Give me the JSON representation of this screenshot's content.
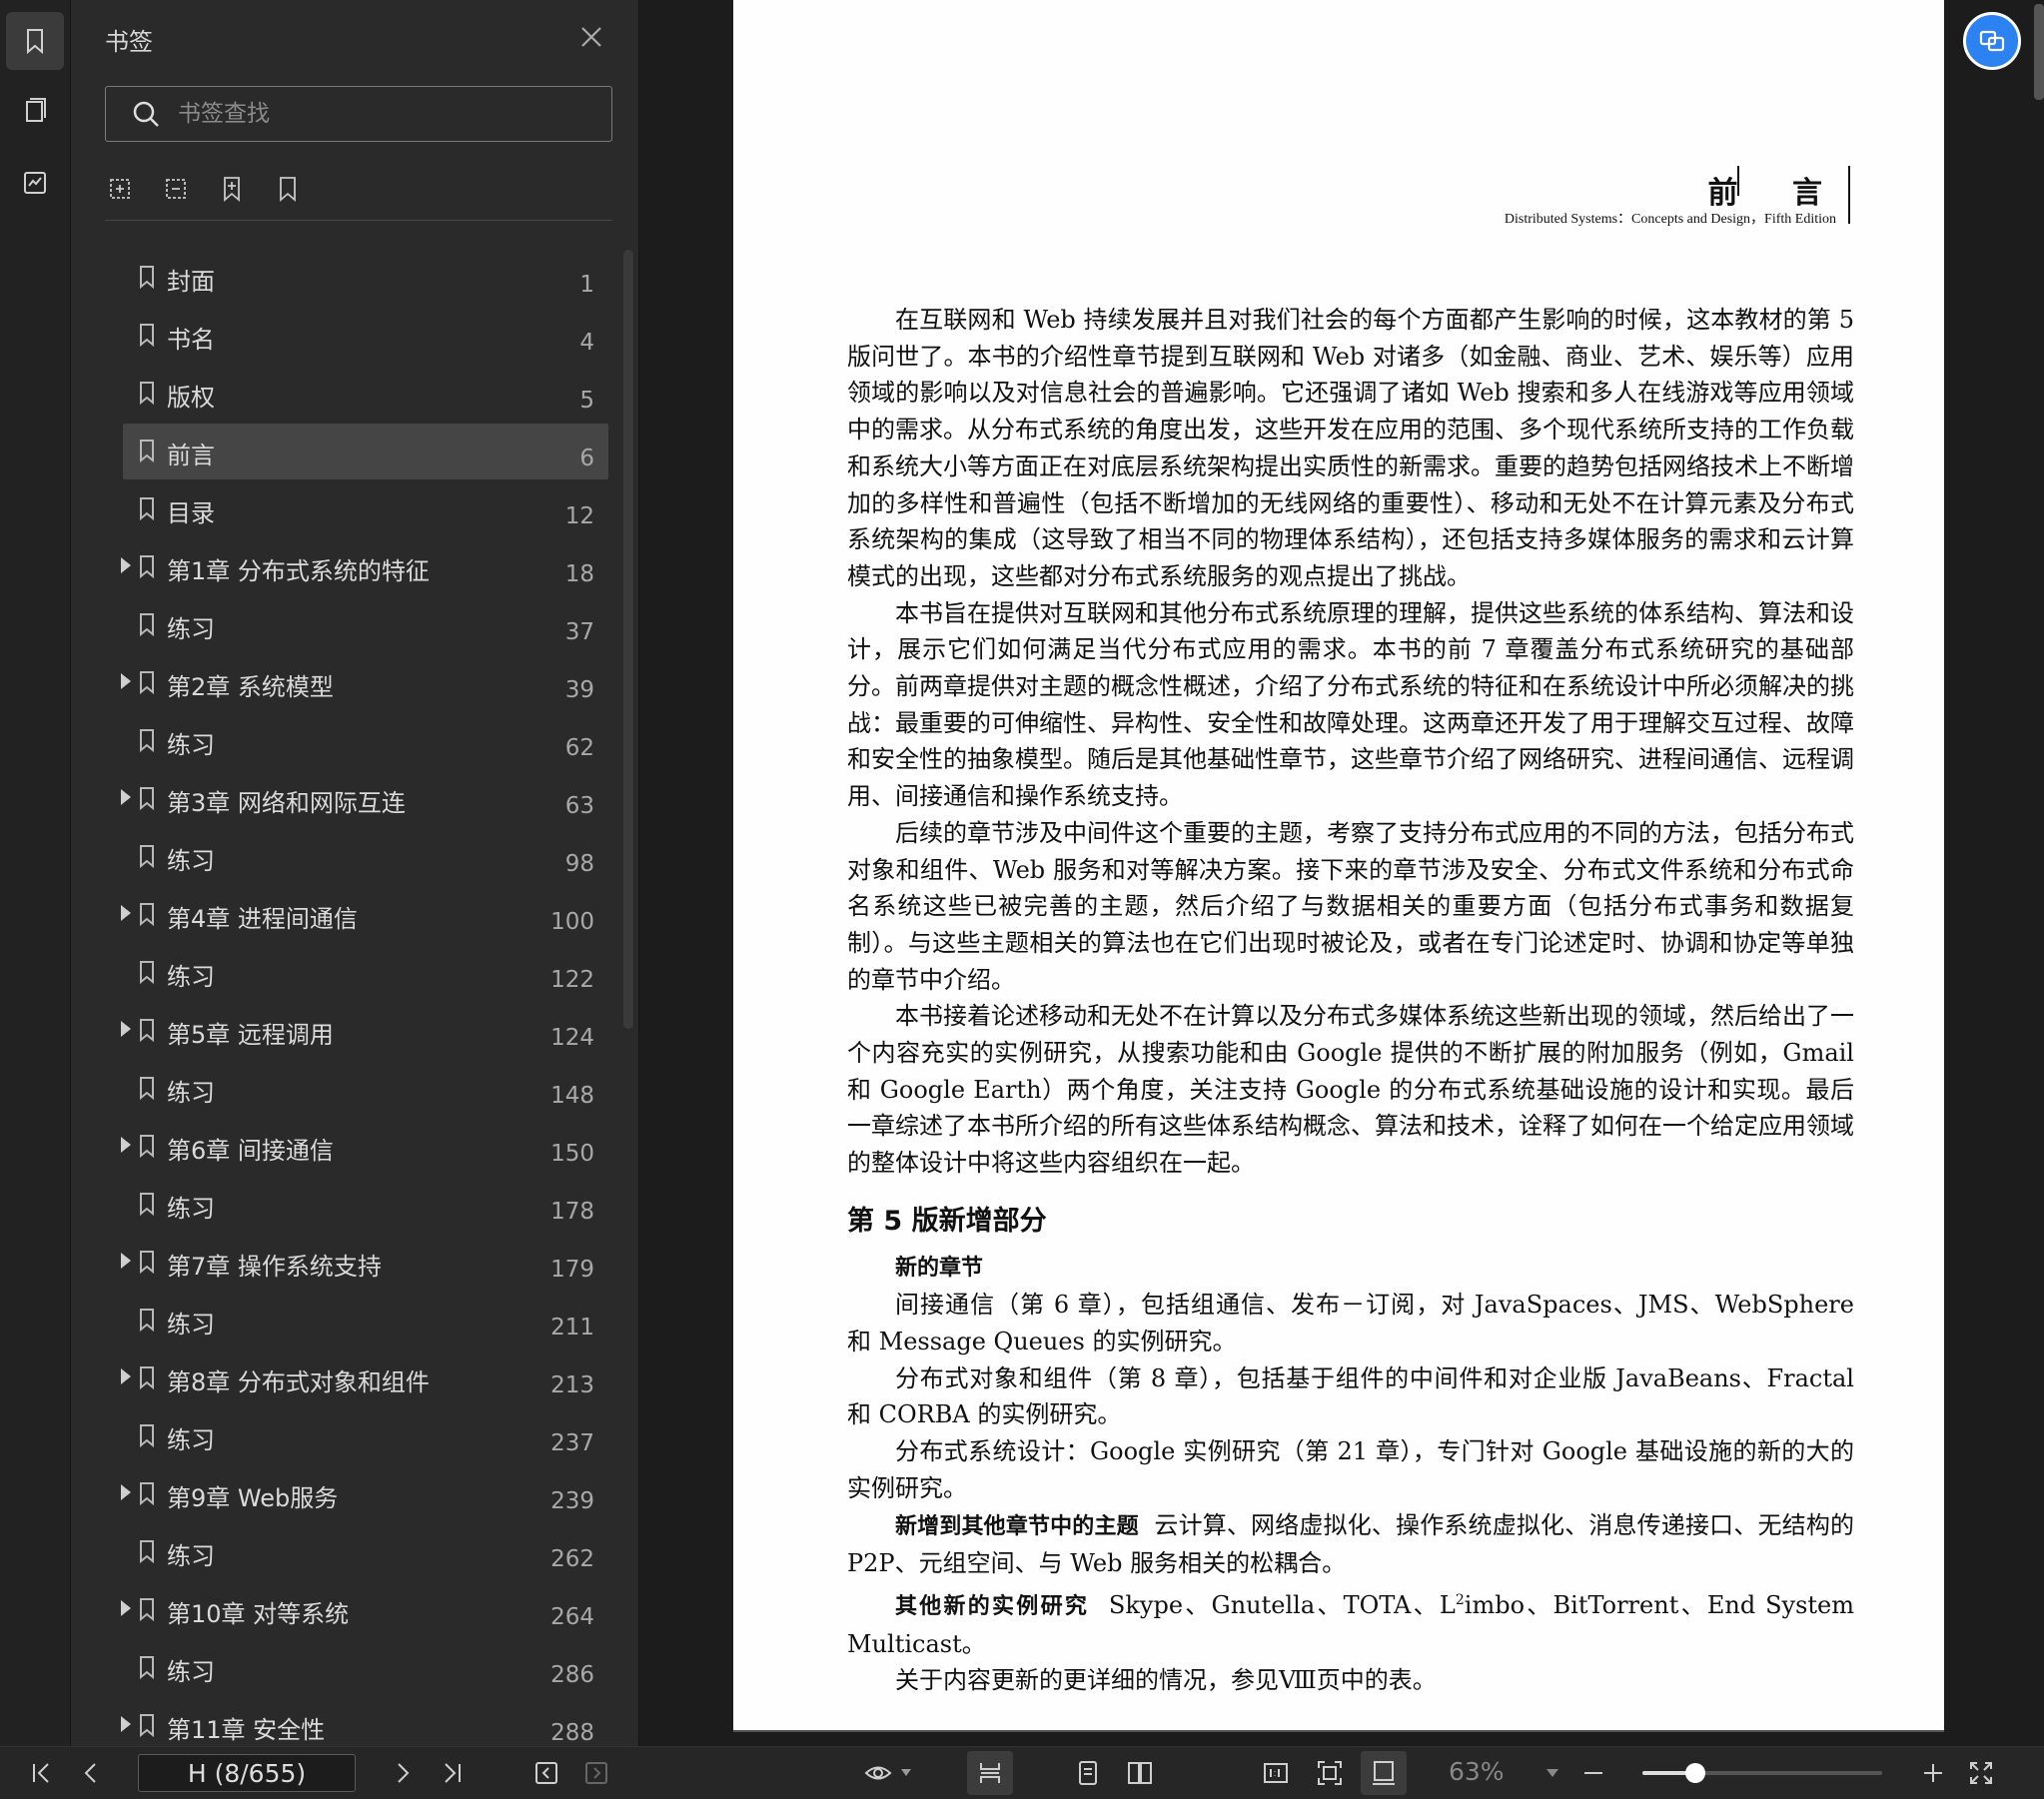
{
  "sidebar": {
    "title": "书签",
    "search_placeholder": "书签查找",
    "bookmarks": [
      {
        "label": "封面",
        "page": "1",
        "expandable": false,
        "selected": false
      },
      {
        "label": "书名",
        "page": "4",
        "expandable": false,
        "selected": false
      },
      {
        "label": "版权",
        "page": "5",
        "expandable": false,
        "selected": false
      },
      {
        "label": "前言",
        "page": "6",
        "expandable": false,
        "selected": true
      },
      {
        "label": "目录",
        "page": "12",
        "expandable": false,
        "selected": false
      },
      {
        "label": "第1章 分布式系统的特征",
        "page": "18",
        "expandable": true,
        "selected": false
      },
      {
        "label": "练习",
        "page": "37",
        "expandable": false,
        "selected": false
      },
      {
        "label": "第2章 系统模型",
        "page": "39",
        "expandable": true,
        "selected": false
      },
      {
        "label": "练习",
        "page": "62",
        "expandable": false,
        "selected": false
      },
      {
        "label": "第3章 网络和网际互连",
        "page": "63",
        "expandable": true,
        "selected": false
      },
      {
        "label": "练习",
        "page": "98",
        "expandable": false,
        "selected": false
      },
      {
        "label": "第4章 进程间通信",
        "page": "100",
        "expandable": true,
        "selected": false
      },
      {
        "label": "练习",
        "page": "122",
        "expandable": false,
        "selected": false
      },
      {
        "label": "第5章 远程调用",
        "page": "124",
        "expandable": true,
        "selected": false
      },
      {
        "label": "练习",
        "page": "148",
        "expandable": false,
        "selected": false
      },
      {
        "label": "第6章 间接通信",
        "page": "150",
        "expandable": true,
        "selected": false
      },
      {
        "label": "练习",
        "page": "178",
        "expandable": false,
        "selected": false
      },
      {
        "label": "第7章 操作系统支持",
        "page": "179",
        "expandable": true,
        "selected": false
      },
      {
        "label": "练习",
        "page": "211",
        "expandable": false,
        "selected": false
      },
      {
        "label": "第8章 分布式对象和组件",
        "page": "213",
        "expandable": true,
        "selected": false
      },
      {
        "label": "练习",
        "page": "237",
        "expandable": false,
        "selected": false
      },
      {
        "label": "第9章 Web服务",
        "page": "239",
        "expandable": true,
        "selected": false
      },
      {
        "label": "练习",
        "page": "262",
        "expandable": false,
        "selected": false
      },
      {
        "label": "第10章 对等系统",
        "page": "264",
        "expandable": true,
        "selected": false
      },
      {
        "label": "练习",
        "page": "286",
        "expandable": false,
        "selected": false
      },
      {
        "label": "第11章 安全性",
        "page": "288",
        "expandable": true,
        "selected": false
      }
    ]
  },
  "document": {
    "header_title": "前 言",
    "header_subtitle": "Distributed Systems：Concepts and Design，Fifth Edition",
    "paragraphs": [
      "在互联网和 Web 持续发展并且对我们社会的每个方面都产生影响的时候，这本教材的第 5 版问世了。本书的介绍性章节提到互联网和 Web 对诸多（如金融、商业、艺术、娱乐等）应用领域的影响以及对信息社会的普遍影响。它还强调了诸如 Web 搜索和多人在线游戏等应用领域中的需求。从分布式系统的角度出发，这些开发在应用的范围、多个现代系统所支持的工作负载和系统大小等方面正在对底层系统架构提出实质性的新需求。重要的趋势包括网络技术上不断增加的多样性和普遍性（包括不断增加的无线网络的重要性）、移动和无处不在计算元素及分布式系统架构的集成（这导致了相当不同的物理体系结构），还包括支持多媒体服务的需求和云计算模式的出现，这些都对分布式系统服务的观点提出了挑战。",
      "本书旨在提供对互联网和其他分布式系统原理的理解，提供这些系统的体系结构、算法和设计，展示它们如何满足当代分布式应用的需求。本书的前 7 章覆盖分布式系统研究的基础部分。前两章提供对主题的概念性概述，介绍了分布式系统的特征和在系统设计中所必须解决的挑战：最重要的可伸缩性、异构性、安全性和故障处理。这两章还开发了用于理解交互过程、故障和安全性的抽象模型。随后是其他基础性章节，这些章节介绍了网络研究、进程间通信、远程调用、间接通信和操作系统支持。",
      "后续的章节涉及中间件这个重要的主题，考察了支持分布式应用的不同的方法，包括分布式对象和组件、Web 服务和对等解决方案。接下来的章节涉及安全、分布式文件系统和分布式命名系统这些已被完善的主题，然后介绍了与数据相关的重要方面（包括分布式事务和数据复制）。与这些主题相关的算法也在它们出现时被论及，或者在专门论述定时、协调和协定等单独的章节中介绍。",
      "本书接着论述移动和无处不在计算以及分布式多媒体系统这些新出现的领域，然后给出了一个内容充实的实例研究，从搜索功能和由 Google 提供的不断扩展的附加服务（例如，Gmail 和 Google Earth）两个角度，关注支持 Google 的分布式系统基础设施的设计和实现。最后一章综述了本书所介绍的所有这些体系结构概念、算法和技术，诠释了如何在一个给定应用领域的整体设计中将这些内容组织在一起。"
    ],
    "section_heading": "第 5 版新增部分",
    "subheading": "新的章节",
    "new_items": [
      "间接通信（第 6 章），包括组通信、发布－订阅，对 JavaSpaces、JMS、WebSphere 和 Message Queues 的实例研究。",
      "分布式对象和组件（第 8 章），包括基于组件的中间件和对企业版 JavaBeans、Fractal 和 CORBA 的实例研究。",
      "分布式系统设计：Google 实例研究（第 21 章），专门针对 Google 基础设施的新的大的实例研究。"
    ],
    "topics_label": "新增到其他章节中的主题",
    "topics_text": "云计算、网络虚拟化、操作系统虚拟化、消息传递接口、无结构的 P2P、元组空间、与 Web 服务相关的松耦合。",
    "cases_label": "其他新的实例研究",
    "cases_text_pre": "Skype、Gnutella、TOTA、L",
    "cases_sup": "2",
    "cases_text_post": "imbo、BitTorrent、End System Multicast。",
    "final_line": "关于内容更新的更详细的情况，参见Ⅷ页中的表。"
  },
  "footer": {
    "page_indicator": "H (8/655)",
    "zoom": "63%",
    "zoom_fraction": 0.22
  },
  "colors": {
    "accent": "#2b82f0",
    "panel_bg": "#2a2a2a",
    "selected_row": "#454545"
  }
}
